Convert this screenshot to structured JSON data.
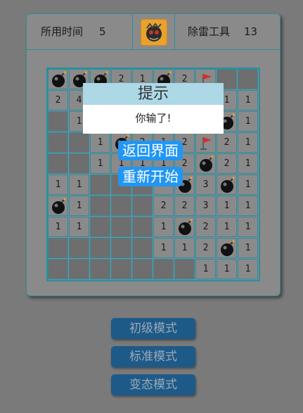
{
  "header": {
    "time_label": "所用时间",
    "time_value": "5",
    "tools_label": "除雷工具",
    "tools_value": "13",
    "avatar_icon": "bomb-avatar-icon"
  },
  "board": {
    "rows": [
      [
        "M",
        "M",
        "M",
        "2",
        "1",
        "M",
        "2",
        "F",
        "H",
        "H"
      ],
      [
        "2",
        "4",
        "",
        "",
        "",
        "",
        "",
        "",
        "1",
        "1"
      ],
      [
        "H",
        "1",
        "",
        "",
        "",
        "",
        "",
        "",
        "M",
        "1"
      ],
      [
        "H",
        "H",
        "1",
        "M",
        "2",
        "1",
        "2",
        "F",
        "2",
        "1"
      ],
      [
        "H",
        "H",
        "1",
        "1",
        "1",
        "1",
        "2",
        "M",
        "2",
        "1"
      ],
      [
        "1",
        "1",
        "H",
        "H",
        "H",
        "",
        "M",
        "3",
        "M",
        "1"
      ],
      [
        "M",
        "1",
        "H",
        "H",
        "H",
        "2",
        "2",
        "3",
        "1",
        "1"
      ],
      [
        "1",
        "1",
        "H",
        "H",
        "H",
        "1",
        "M",
        "2",
        "1",
        "1"
      ],
      [
        "H",
        "H",
        "H",
        "H",
        "H",
        "1",
        "1",
        "2",
        "M",
        "1"
      ],
      [
        "H",
        "H",
        "H",
        "H",
        "H",
        "H",
        "H",
        "1",
        "1",
        "1"
      ]
    ]
  },
  "dialog": {
    "title": "提示",
    "message": "你输了!",
    "back_label": "返回界面",
    "restart_label": "重新开始"
  },
  "modes": {
    "beginner": "初级模式",
    "standard": "标准模式",
    "extreme": "变态模式"
  },
  "colors": {
    "accent_border": "#2a8fa0",
    "dialog_title_bg": "#add8e6",
    "overlay_button": "#2196f3",
    "mode_button": "#1e5a88",
    "flag": "#d32f2f"
  }
}
